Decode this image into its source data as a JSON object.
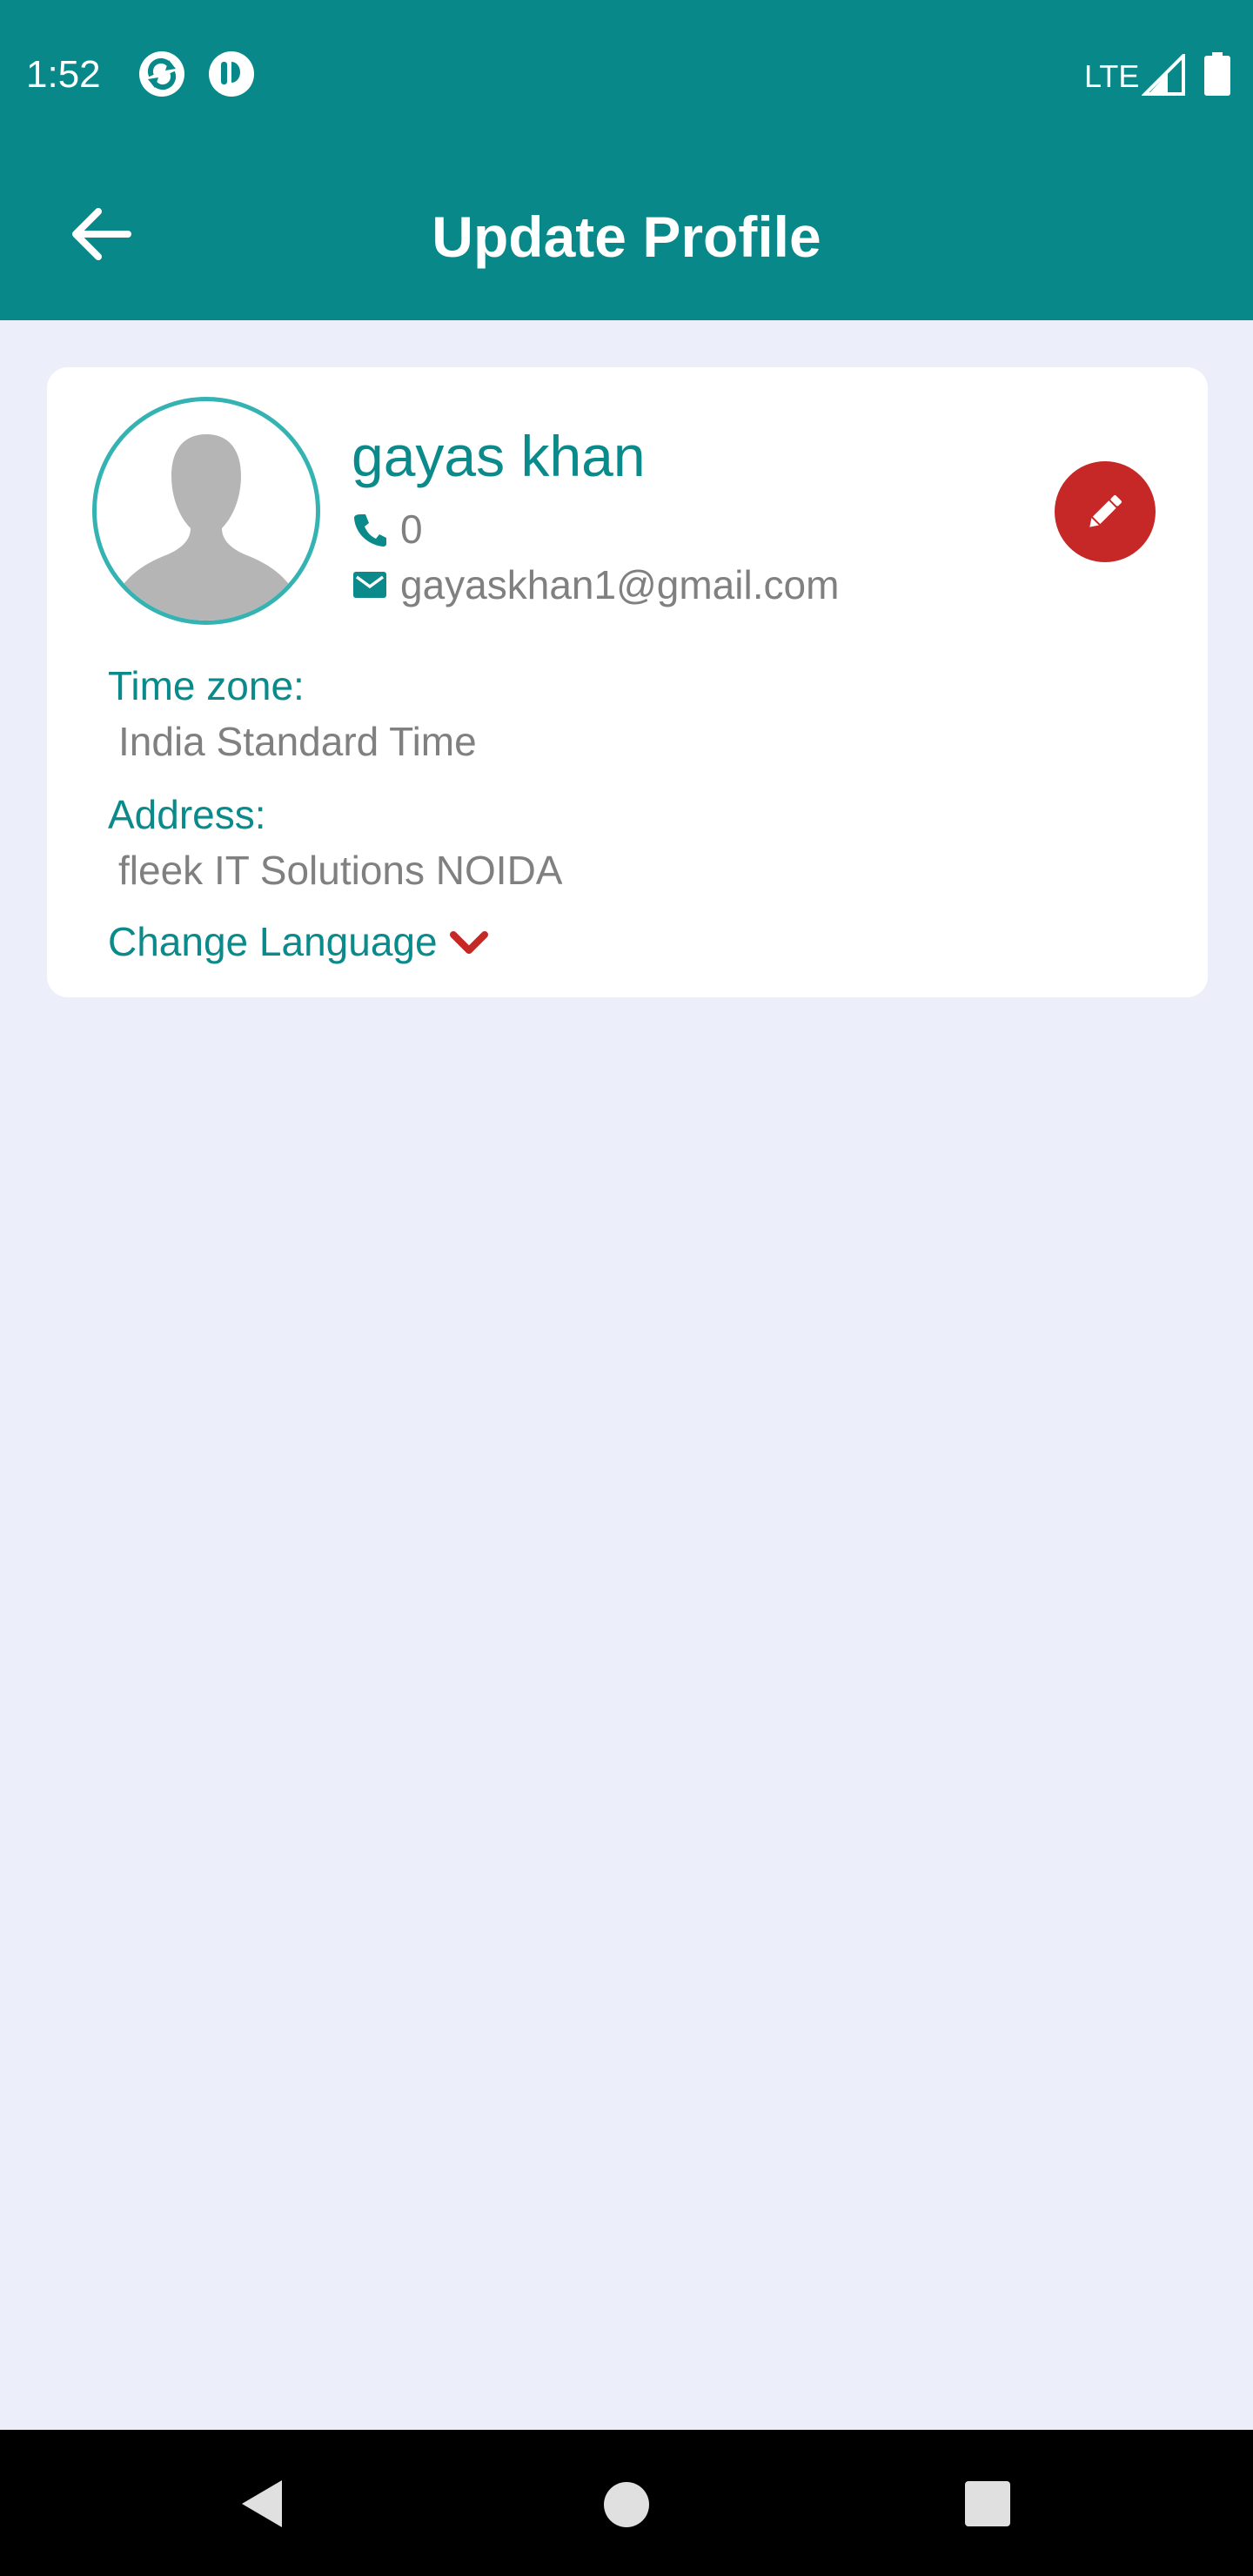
{
  "status_bar": {
    "time": "1:52",
    "network": "LTE",
    "icons": [
      "sync-app-icon",
      "app-notification-icon",
      "signal-icon",
      "battery-icon"
    ]
  },
  "app_bar": {
    "title": "Update Profile",
    "back_icon": "arrow-left-icon"
  },
  "profile": {
    "name": "gayas khan",
    "phone": "0",
    "email": "gayaskhan1@gmail.com",
    "avatar_icon": "person-silhouette-icon",
    "edit_icon": "pencil-icon"
  },
  "details": {
    "timezone_label": "Time zone:",
    "timezone_value": "India Standard Time",
    "address_label": "Address:",
    "address_value": "fleek IT Solutions NOIDA",
    "change_language_label": "Change Language"
  },
  "colors": {
    "primary": "#088888",
    "accent_text": "#0a8a8a",
    "edit_button": "#c62828",
    "background": "#eceefa",
    "muted_text": "#808080"
  }
}
